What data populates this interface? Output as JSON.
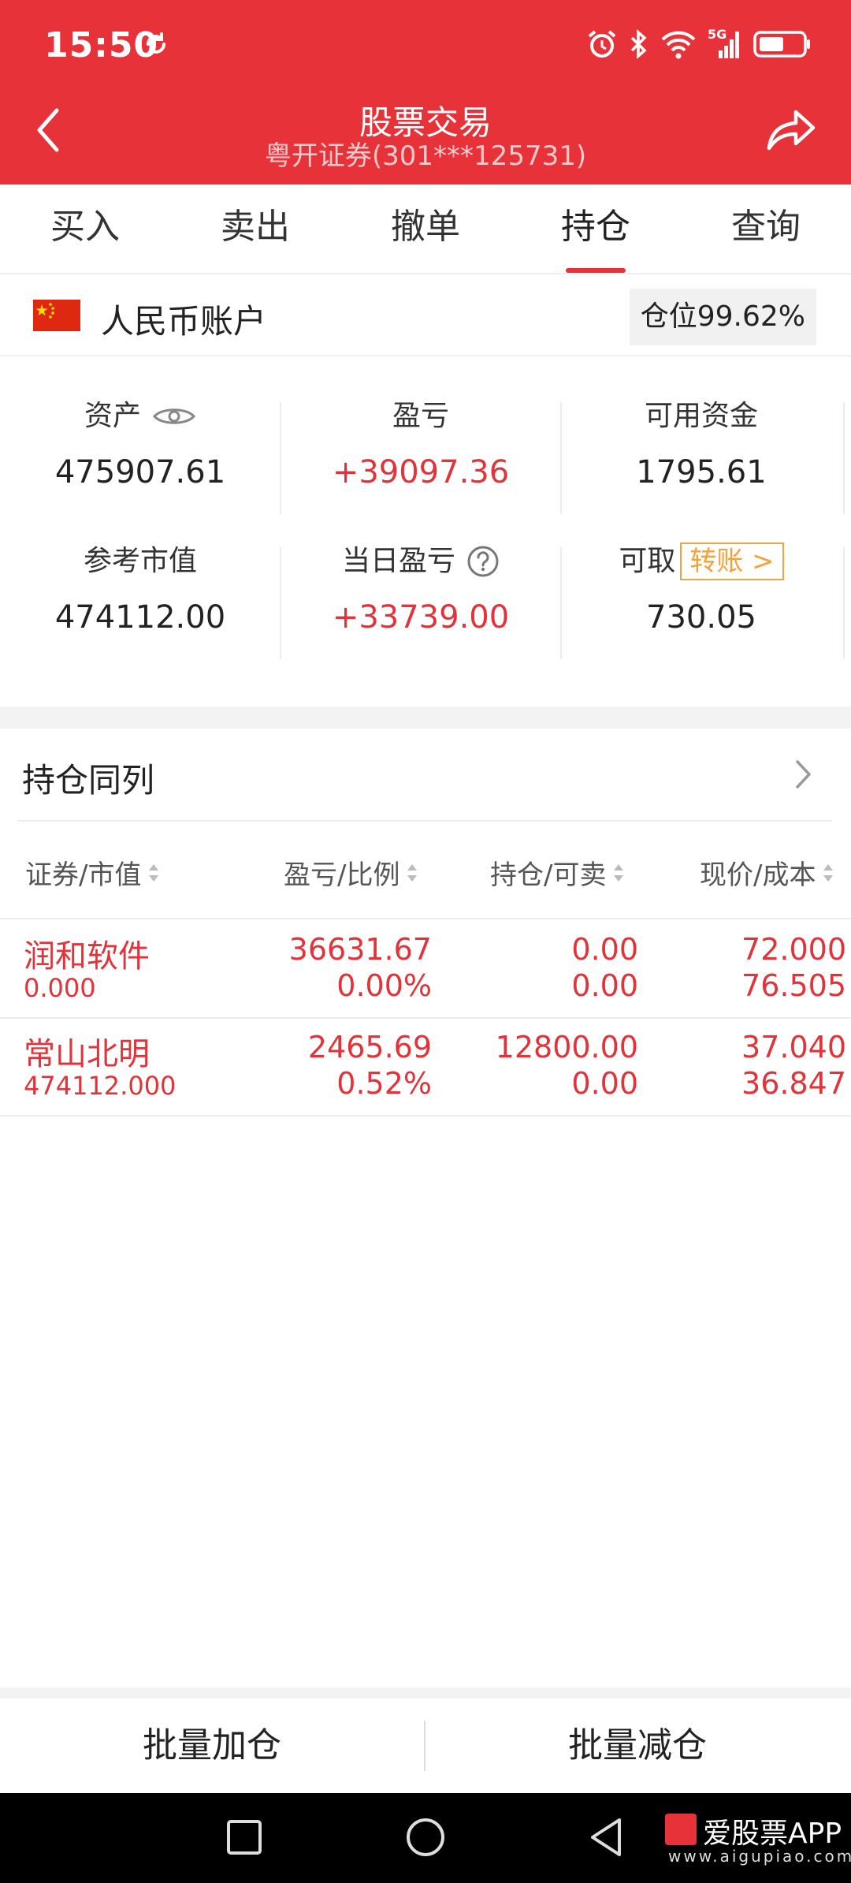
{
  "status_bar": {
    "time": "15:50",
    "network": "5G"
  },
  "header": {
    "title": "股票交易",
    "subtitle": "粤开证券(301***125731)"
  },
  "tabs": [
    {
      "label": "买入"
    },
    {
      "label": "卖出"
    },
    {
      "label": "撤单"
    },
    {
      "label": "持仓",
      "active": true
    },
    {
      "label": "查询"
    }
  ],
  "account": {
    "label": "人民币账户",
    "position_badge": "仓位99.62%"
  },
  "summary": {
    "assets_label": "资产",
    "assets_value": "475907.61",
    "pnl_label": "盈亏",
    "pnl_value": "+39097.36",
    "available_label": "可用资金",
    "available_value": "1795.61",
    "market_value_label": "参考市值",
    "market_value_value": "474112.00",
    "daily_pnl_label": "当日盈亏",
    "daily_pnl_value": "+33739.00",
    "withdrawable_label": "可取",
    "transfer_label": "转账 >",
    "withdrawable_value": "730.05"
  },
  "holdings": {
    "title": "持仓同列",
    "columns": [
      "证券/市值",
      "盈亏/比例",
      "持仓/可卖",
      "现价/成本"
    ],
    "rows": [
      {
        "name": "润和软件",
        "market_value": "0.000",
        "pnl": "36631.67",
        "ratio": "0.00%",
        "holding": "0.00",
        "sellable": "0.00",
        "price": "72.000",
        "cost": "76.505"
      },
      {
        "name": "常山北明",
        "market_value": "474112.000",
        "pnl": "2465.69",
        "ratio": "0.52%",
        "holding": "12800.00",
        "sellable": "0.00",
        "price": "37.040",
        "cost": "36.847"
      }
    ]
  },
  "bottom_actions": {
    "batch_add": "批量加仓",
    "batch_reduce": "批量减仓"
  },
  "watermark": {
    "name": "爱股票APP",
    "url": "www.aigupiao.com"
  },
  "colors": {
    "brand_red": "#e8323a",
    "gain_red": "#e3333a",
    "transfer_orange": "#f2a33a"
  }
}
